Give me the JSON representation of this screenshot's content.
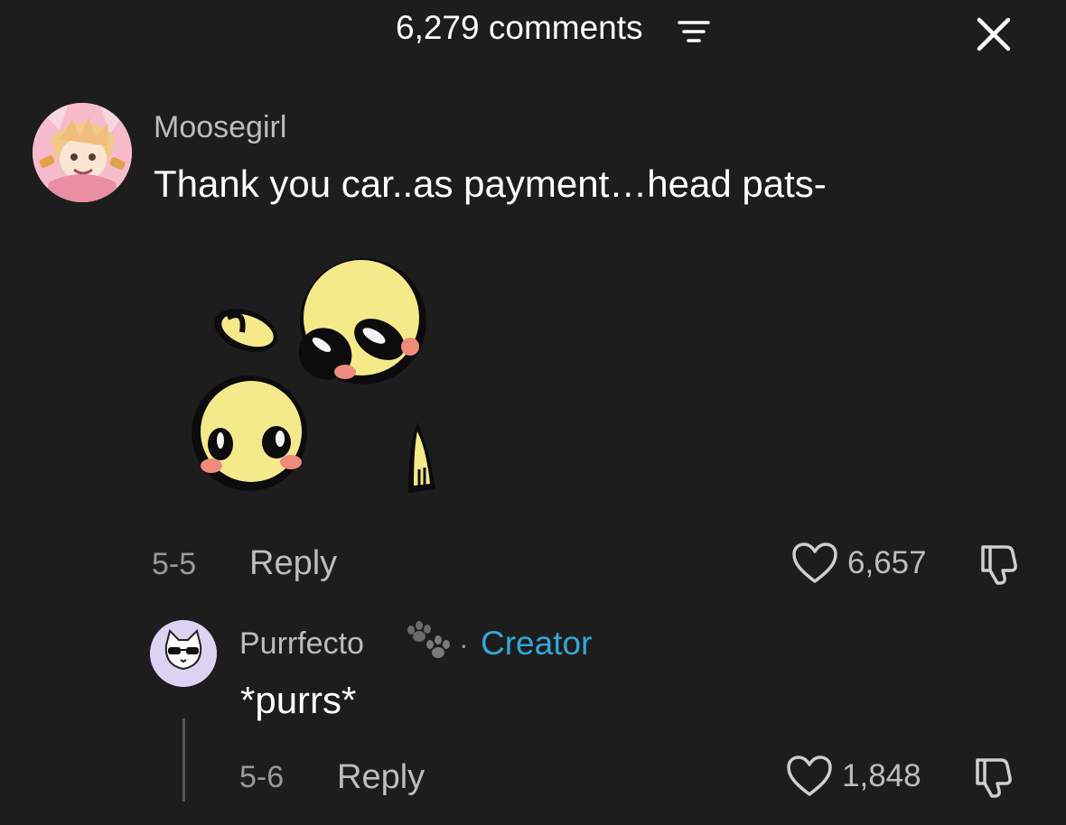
{
  "header": {
    "comment_count": "6,279 comments",
    "sort_icon": "sort-lines-icon",
    "close_icon": "close-x-icon"
  },
  "comment": {
    "username": "Moosegirl",
    "text": "Thank you car..as payment…head pats-",
    "sticker": "head-pat-duck-sticker",
    "date": "5-5",
    "reply_label": "Reply",
    "like_count": "6,657",
    "avatar": "anime-character-avatar"
  },
  "reply": {
    "username": "Purrfecto",
    "separator": "·",
    "badge": "Creator",
    "text": "*purrs*",
    "date": "5-6",
    "reply_label": "Reply",
    "like_count": "1,848",
    "avatar": "cat-sunglasses-avatar"
  },
  "colors": {
    "background": "#1d1d1d",
    "creator_badge": "#35a7d6",
    "secondary_text": "#bdbdbd"
  }
}
